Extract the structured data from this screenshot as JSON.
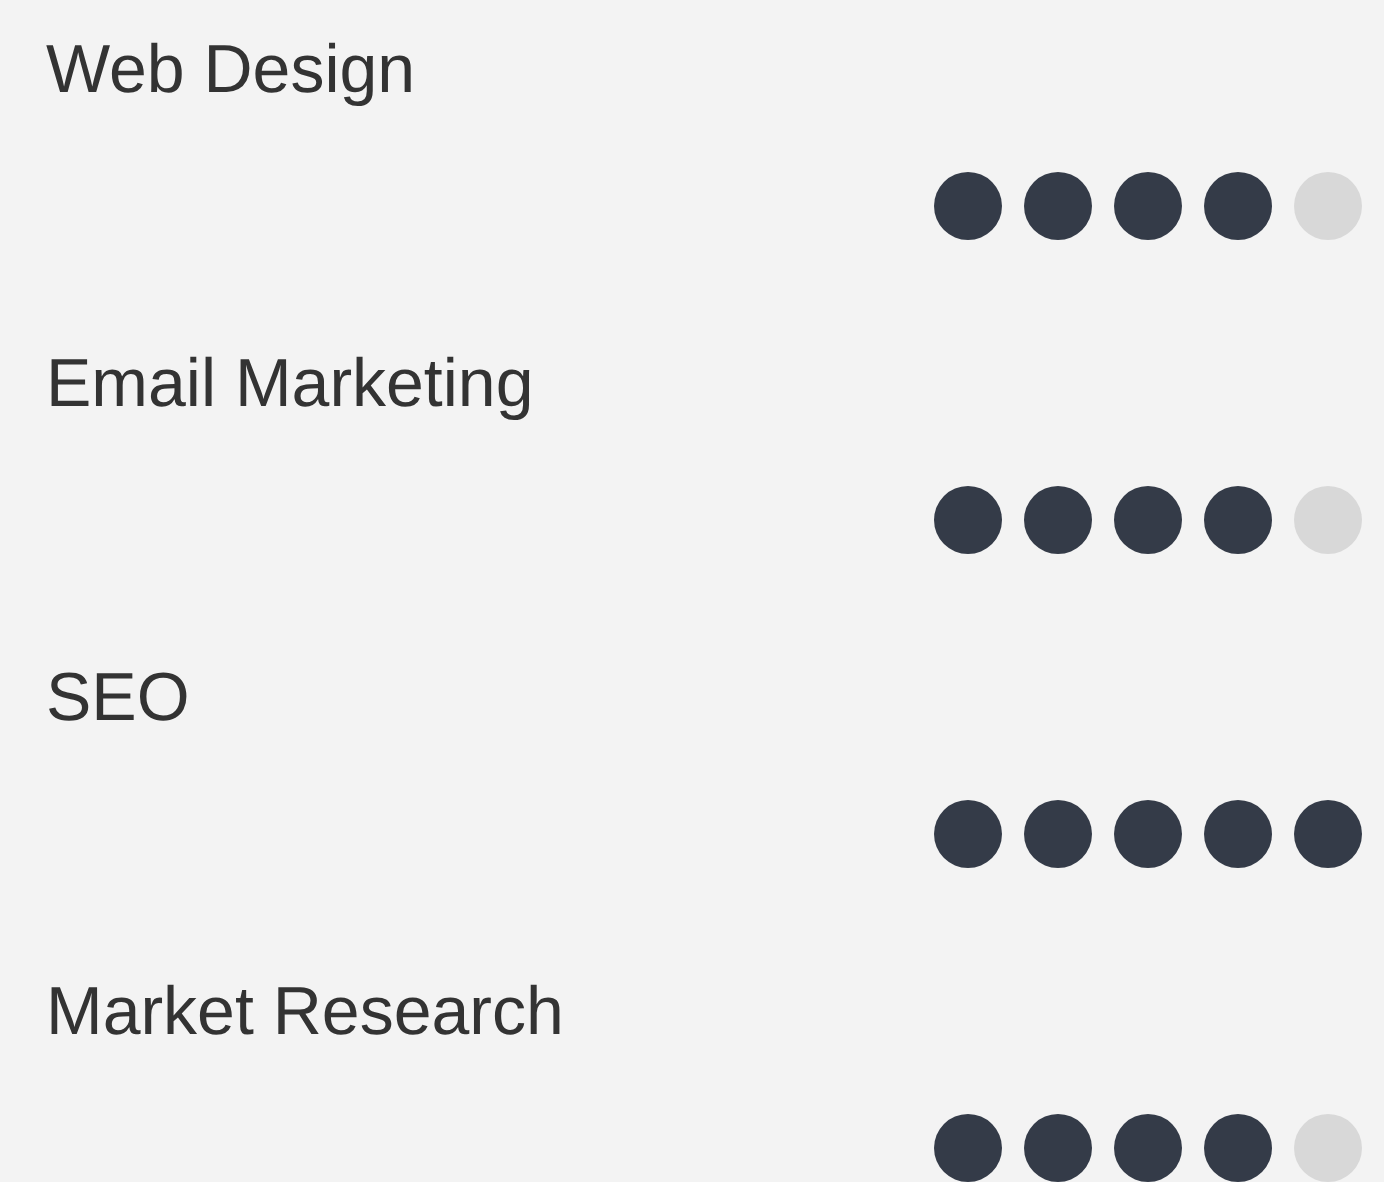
{
  "skills": [
    {
      "name": "Web Design",
      "stars": 4
    },
    {
      "name": "Email Marketing",
      "stars": 4
    },
    {
      "name": "SEO",
      "stars": 5
    },
    {
      "name": "Market Research",
      "stars": 4
    }
  ]
}
